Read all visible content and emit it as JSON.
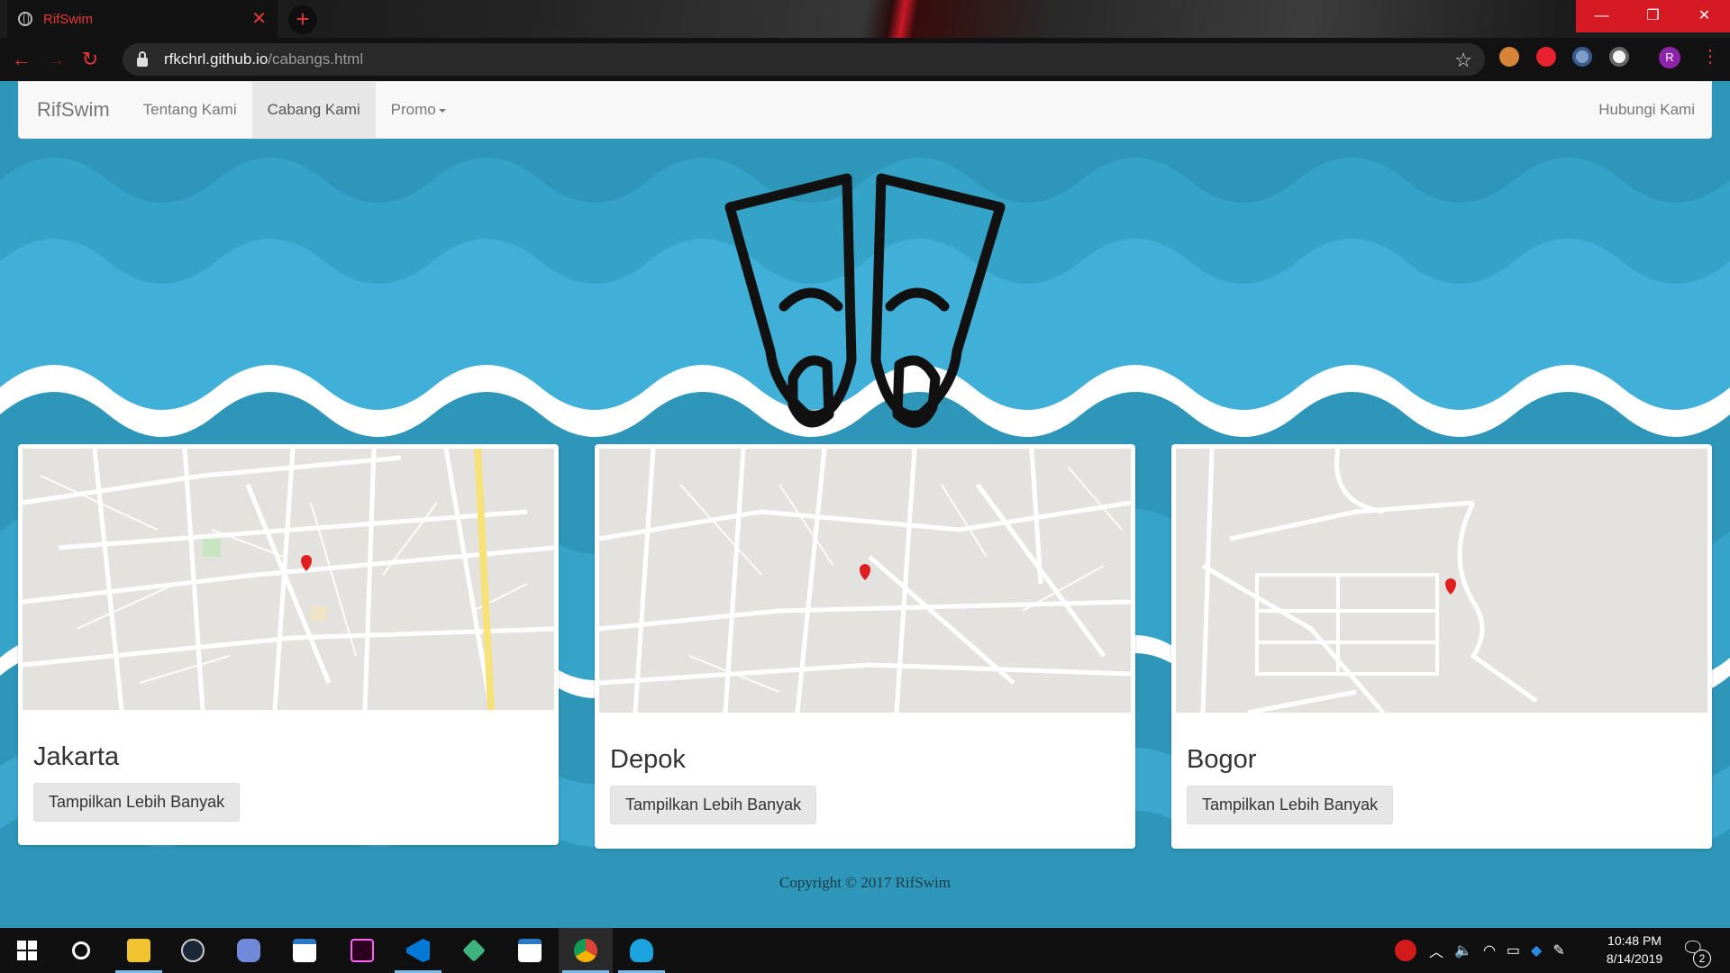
{
  "browser": {
    "tab_title": "RifSwim",
    "tab_close": "✕",
    "new_tab": "+",
    "url_host": "rfkchrl.github.io",
    "url_path": "/cabangs.html",
    "back": "←",
    "forward": "→",
    "reload": "↻",
    "bookmark": "☆",
    "avatar_initial": "R",
    "menu": "⋮",
    "minimize": "—",
    "maximize": "❐",
    "close": "✕"
  },
  "navbar": {
    "brand": "RifSwim",
    "items": [
      {
        "label": "Tentang Kami"
      },
      {
        "label": "Cabang Kami"
      },
      {
        "label": "Promo"
      }
    ],
    "right": "Hubungi Kami"
  },
  "cards": [
    {
      "title": "Jakarta",
      "button": "Tampilkan Lebih Banyak"
    },
    {
      "title": "Depok",
      "button": "Tampilkan Lebih Banyak"
    },
    {
      "title": "Bogor",
      "button": "Tampilkan Lebih Banyak"
    }
  ],
  "footer": "Copyright © 2017 RifSwim",
  "taskbar": {
    "time": "10:48 PM",
    "date": "8/14/2019",
    "notification_count": "2"
  },
  "colors": {
    "wave_dark": "#2e96b8",
    "wave_light": "#40b0d9",
    "wave_white": "#ffffff",
    "chrome_accent": "#e53935",
    "window_controls": "#d61a24"
  },
  "icons": {
    "logo": "swim-fins-icon",
    "map_pin": "map-pin-icon"
  }
}
